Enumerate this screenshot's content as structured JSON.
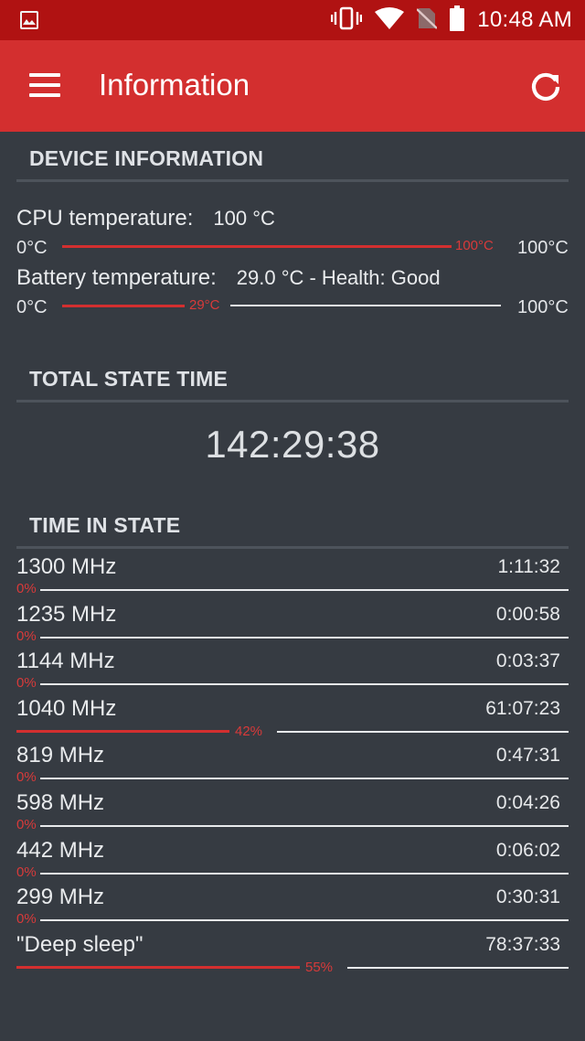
{
  "status_bar": {
    "time": "10:48 AM",
    "icons": [
      "gallery-icon",
      "vibrate-icon",
      "wifi-icon",
      "no-sim-icon",
      "battery-icon"
    ]
  },
  "app_bar": {
    "title": "Information",
    "menu_icon": "menu-icon",
    "refresh_icon": "refresh-icon"
  },
  "colors": {
    "status_bar": "#b01212",
    "app_bar": "#d32f2f",
    "background": "#363b42",
    "accent": "#d32f2f"
  },
  "device_information": {
    "header": "DEVICE INFORMATION",
    "cpu": {
      "label": "CPU temperature:",
      "value": "100 °C",
      "min_label": "0°C",
      "max_label": "100°C",
      "bar_label": "100°C",
      "level_percent": 100
    },
    "battery": {
      "label": "Battery temperature:",
      "value": "29.0 °C - Health: Good",
      "min_label": "0°C",
      "max_label": "100°C",
      "bar_label": "29°C",
      "level_percent": 29
    }
  },
  "total_state_time": {
    "header": "TOTAL STATE TIME",
    "value": "142:29:38"
  },
  "time_in_state": {
    "header": "TIME IN STATE",
    "states": [
      {
        "freq": "1300 MHz",
        "time": "1:11:32",
        "pct": "0%",
        "level_percent": 0
      },
      {
        "freq": "1235 MHz",
        "time": "0:00:58",
        "pct": "0%",
        "level_percent": 0
      },
      {
        "freq": "1144 MHz",
        "time": "0:03:37",
        "pct": "0%",
        "level_percent": 0
      },
      {
        "freq": "1040 MHz",
        "time": "61:07:23",
        "pct": "42%",
        "level_percent": 42
      },
      {
        "freq": "819 MHz",
        "time": "0:47:31",
        "pct": "0%",
        "level_percent": 0
      },
      {
        "freq": "598 MHz",
        "time": "0:04:26",
        "pct": "0%",
        "level_percent": 0
      },
      {
        "freq": "442 MHz",
        "time": "0:06:02",
        "pct": "0%",
        "level_percent": 0
      },
      {
        "freq": "299 MHz",
        "time": "0:30:31",
        "pct": "0%",
        "level_percent": 0
      },
      {
        "freq": "\"Deep sleep\"",
        "time": "78:37:33",
        "pct": "55%",
        "level_percent": 55
      }
    ]
  }
}
